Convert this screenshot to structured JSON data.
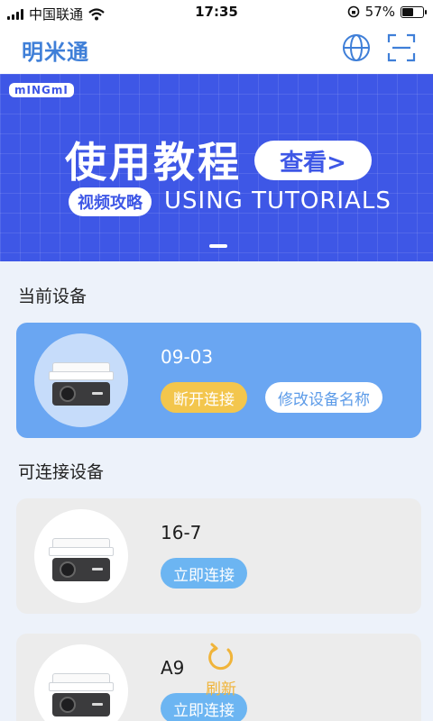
{
  "status_bar": {
    "carrier": "中国联通",
    "time": "17:35",
    "battery_percent": 57,
    "battery_label": "57%"
  },
  "app_bar": {
    "brand": "明米通",
    "icons": [
      "globe-icon",
      "scan-icon"
    ],
    "brand_color": "#3f7fd8"
  },
  "banner": {
    "logo": "mINGmI",
    "title": "使用教程",
    "view_button": "查看>",
    "video_pill": "视频攻略",
    "subtitle": "USING TUTORIALS",
    "background_color": "#3e57e6"
  },
  "current_section": {
    "title": "当前设备",
    "device": {
      "name": "09-03",
      "disconnect_label": "断开连接",
      "rename_label": "修改设备名称"
    }
  },
  "available_section": {
    "title": "可连接设备",
    "devices": [
      {
        "name": "16-7",
        "connect_label": "立即连接"
      },
      {
        "name": "A9",
        "connect_label": "立即连接"
      }
    ]
  },
  "refresh": {
    "label": "刷新",
    "color": "#f0b43a"
  }
}
